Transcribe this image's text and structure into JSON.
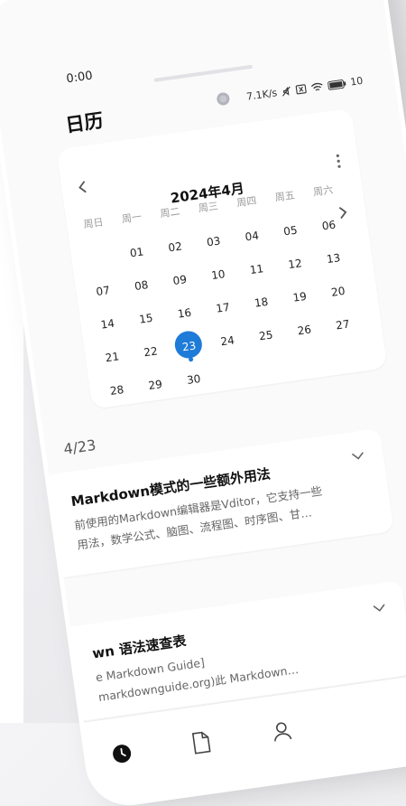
{
  "status": {
    "time": "0:00",
    "net_speed": "7.1K/s",
    "battery_text": "10"
  },
  "app": {
    "title": "日历"
  },
  "calendar": {
    "month_title": "2024年4月",
    "weekdays": [
      "周日",
      "周一",
      "周二",
      "周三",
      "周四",
      "周五",
      "周六"
    ],
    "weeks": [
      [
        "",
        "01",
        "02",
        "03",
        "04",
        "05",
        "06"
      ],
      [
        "07",
        "08",
        "09",
        "10",
        "11",
        "12",
        "13"
      ],
      [
        "14",
        "15",
        "16",
        "17",
        "18",
        "19",
        "20"
      ],
      [
        "21",
        "22",
        "23",
        "24",
        "25",
        "26",
        "27"
      ],
      [
        "28",
        "29",
        "30",
        "",
        "",
        "",
        ""
      ]
    ],
    "selected_day": "23"
  },
  "selected_date_label": "4/23",
  "notes": [
    {
      "title": "Markdown模式的一些额外用法",
      "line1": "前使用的Markdown编辑器是Vditor，它支持一些",
      "line2": "用法，数学公式、脑图、流程图、时序图、甘…"
    },
    {
      "title": "wn 语法速查表",
      "line1": "e Markdown Guide]",
      "line2": "markdownguide.org)此 Markdown…"
    }
  ],
  "tabs": [
    {
      "name": "clock-icon"
    },
    {
      "name": "document-icon"
    },
    {
      "name": "person-icon"
    }
  ],
  "colors": {
    "accent": "#1e7bd8",
    "background": "#fafafb",
    "card": "#ffffff"
  }
}
